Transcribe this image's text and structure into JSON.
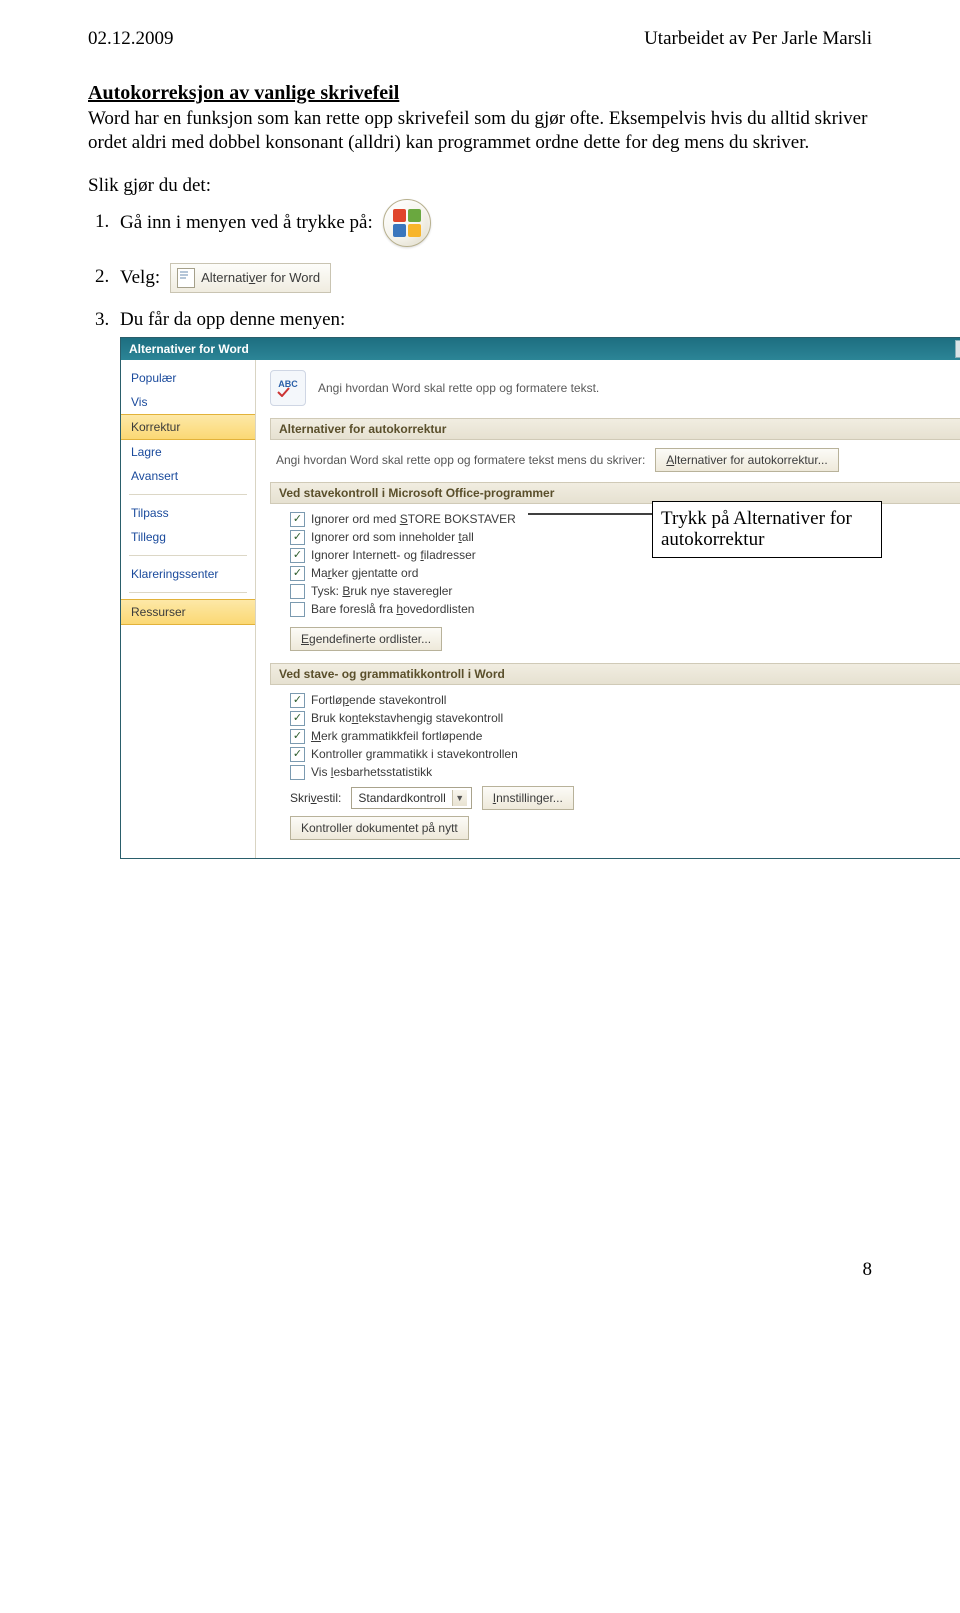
{
  "header": {
    "left": "02.12.2009",
    "right": "Utarbeidet av Per Jarle Marsli"
  },
  "title": "Autokorreksjon av vanlige skrivefeil",
  "intro": "Word har en funksjon som kan rette opp skrivefeil som du gjør ofte. Eksempelvis hvis du alltid skriver ordet aldri med dobbel konsonant (alldri) kan programmet ordne dette for deg mens du skriver.",
  "steps_heading": "Slik gjør du det:",
  "steps": {
    "s1": "Gå inn i menyen ved å trykke på:",
    "s2": "Velg:",
    "s3": "Du får da opp denne menyen:"
  },
  "word_opt_btn": "Alternativer for Word",
  "dialog": {
    "title": "Alternativer for Word",
    "sysbtns": {
      "help": "?",
      "close": "×"
    },
    "sidebar": [
      "Populær",
      "Vis",
      "Korrektur",
      "Lagre",
      "Avansert",
      "Tilpass",
      "Tillegg",
      "Klareringssenter",
      "Ressurser"
    ],
    "intro_label": "ABC",
    "intro_text": "Angi hvordan Word skal rette opp og formatere tekst.",
    "sec1": "Alternativer for autokorrektur",
    "sec1_row": "Angi hvordan Word skal rette opp og formatere tekst mens du skriver:",
    "sec1_btn": "Alternativer for autokorrektur...",
    "sec2": "Ved stavekontroll i Microsoft Office-programmer",
    "sec2_checks": [
      {
        "checked": true,
        "pre": "Ignorer ord med ",
        "u": "S",
        "post": "TORE BOKSTAVER"
      },
      {
        "checked": true,
        "pre": "Ignorer ord som inneholder ",
        "u": "t",
        "post": "all"
      },
      {
        "checked": true,
        "pre": "Ignorer Internett- og ",
        "u": "f",
        "post": "iladresser"
      },
      {
        "checked": true,
        "pre": "Ma",
        "u": "r",
        "post": "ker gjentatte ord"
      },
      {
        "checked": false,
        "pre": "Tysk: ",
        "u": "B",
        "post": "ruk nye staveregler"
      },
      {
        "checked": false,
        "pre": "Bare foreslå fra ",
        "u": "h",
        "post": "ovedordlisten"
      }
    ],
    "sec2_btn": "Egendefinerte ordlister...",
    "sec3": "Ved stave- og grammatikkontroll i Word",
    "sec3_checks": [
      {
        "checked": true,
        "pre": "Fortlø",
        "u": "p",
        "post": "ende stavekontroll"
      },
      {
        "checked": true,
        "pre": "Bruk ko",
        "u": "n",
        "post": "tekstavhengig stavekontroll"
      },
      {
        "checked": true,
        "pre": "",
        "u": "M",
        "post": "erk grammatikkfeil fortløpende"
      },
      {
        "checked": true,
        "pre": "Kontroller grammatikk i stavekontrollen",
        "u": "",
        "post": ""
      },
      {
        "checked": false,
        "pre": "Vis ",
        "u": "l",
        "post": "esbarhetsstatistikk"
      }
    ],
    "writing_style_label": "Skrivestil:",
    "writing_style_value": "Standardkontroll",
    "settings_btn": "Innstillinger...",
    "recheck_btn": "Kontroller dokumentet på nytt"
  },
  "callout": "Trykk på Alternativer for autokorrektur",
  "page_number": "8"
}
